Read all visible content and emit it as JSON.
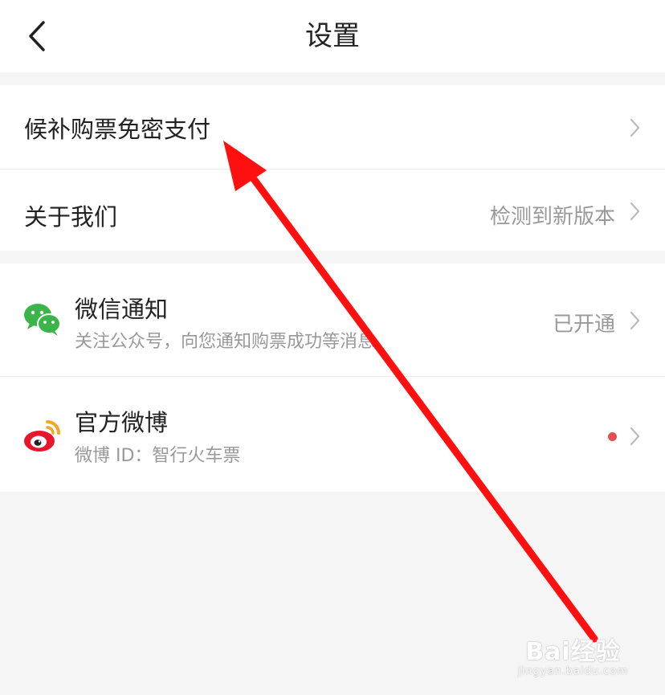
{
  "header": {
    "title": "设置",
    "back_icon": "chevron-left-icon"
  },
  "group1": {
    "items": [
      {
        "title": "候补购票免密支付",
        "value": ""
      },
      {
        "title": "关于我们",
        "value": "检测到新版本"
      }
    ]
  },
  "group2": {
    "wechat": {
      "title": "微信通知",
      "subtitle": "关注公众号，向您通知购票成功等消息",
      "value": "已开通",
      "icon": "wechat-icon"
    },
    "weibo": {
      "title": "官方微博",
      "subtitle": "微博 ID：智行火车票",
      "icon": "weibo-icon"
    }
  },
  "watermark": {
    "main": "Bai经验",
    "sub": "jingyan.baidu.com"
  },
  "colors": {
    "wechat_green": "#3bb54a",
    "weibo_red": "#e6162d",
    "arrow_red": "#ff1010",
    "badge_red": "#e45050"
  }
}
